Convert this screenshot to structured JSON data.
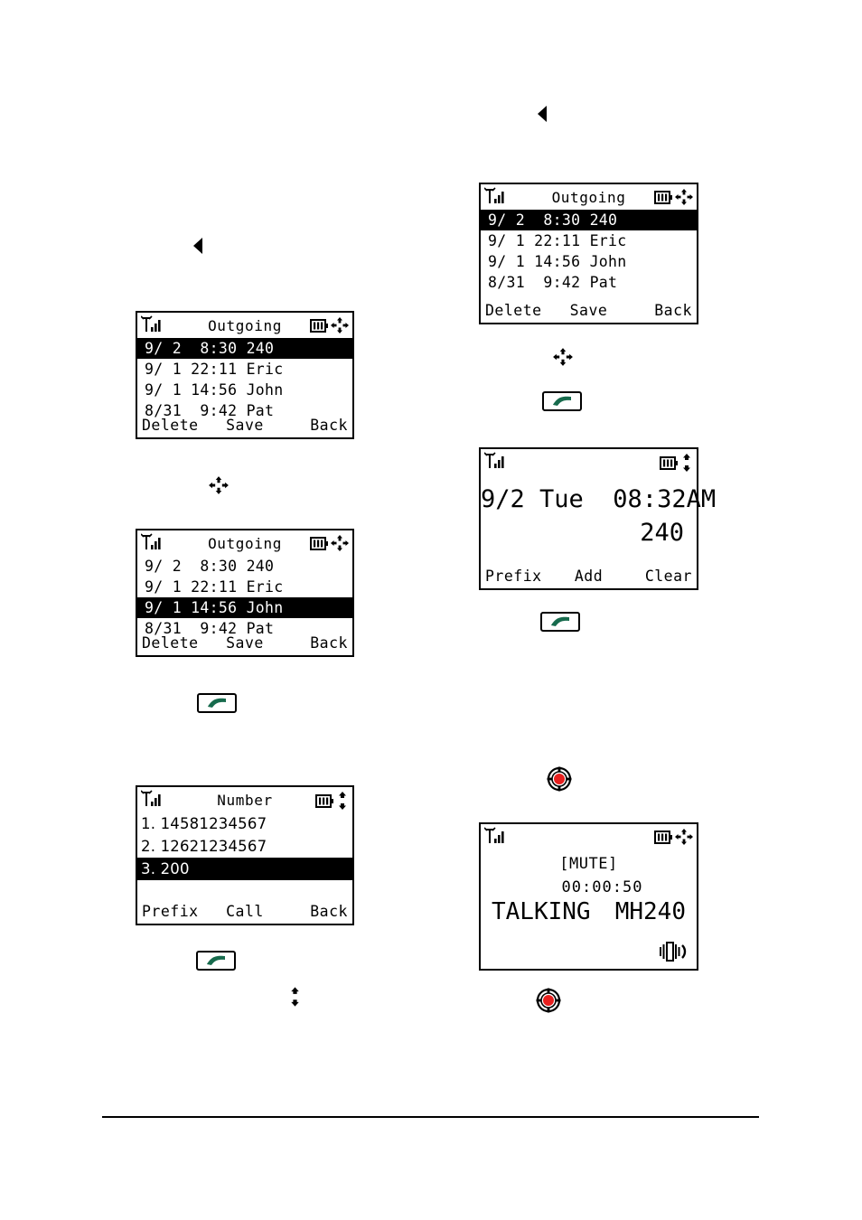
{
  "doc": {
    "type": "phone-manual-flow-diagram",
    "background": "#ffffff",
    "rule_color": "#000000"
  },
  "icons": {
    "signal": "signal-bars-icon",
    "battery": "battery-icon",
    "fourway": "four-way-navigation-icon",
    "updown": "up-down-navigation-icon",
    "triangle_left": "left-triangle-icon",
    "call_button": "green-call-button-icon",
    "mute_button": "red-mute-button-icon",
    "speaker": "speaker-vibrate-icon"
  },
  "screens": {
    "outgoing_left_1": {
      "title": "Outgoing",
      "rows": [
        {
          "text": "9/ 2  8:30 240",
          "selected": true
        },
        {
          "text": "9/ 1 22:11 Eric",
          "selected": false
        },
        {
          "text": "9/ 1 14:56 John",
          "selected": false
        },
        {
          "text": "8/31  9:42 Pat",
          "selected": false
        }
      ],
      "softkeys": {
        "left": "Delete",
        "center": "Save",
        "right": "Back"
      }
    },
    "outgoing_left_2": {
      "title": "Outgoing",
      "rows": [
        {
          "text": "9/ 2  8:30 240",
          "selected": false
        },
        {
          "text": "9/ 1 22:11 Eric",
          "selected": false
        },
        {
          "text": "9/ 1 14:56 John",
          "selected": true
        },
        {
          "text": "8/31  9:42 Pat",
          "selected": false
        }
      ],
      "softkeys": {
        "left": "Delete",
        "center": "Save",
        "right": "Back"
      }
    },
    "number_list": {
      "title": "Number",
      "rows": [
        {
          "text": "1. 14581234567",
          "selected": false
        },
        {
          "text": "2. 12621234567",
          "selected": false
        },
        {
          "text": "3. 200",
          "selected": true
        }
      ],
      "softkeys": {
        "left": "Prefix",
        "center": "Call",
        "right": "Back"
      }
    },
    "outgoing_right_1": {
      "title": "Outgoing",
      "rows": [
        {
          "text": "9/ 2  8:30 240",
          "selected": true
        },
        {
          "text": "9/ 1 22:11 Eric",
          "selected": false
        },
        {
          "text": "9/ 1 14:56 John",
          "selected": false
        },
        {
          "text": "8/31  9:42 Pat",
          "selected": false
        }
      ],
      "softkeys": {
        "left": "Delete",
        "center": "Save",
        "right": "Back"
      }
    },
    "dial": {
      "datetime": "9/2 Tue  08:32AM",
      "number": "240",
      "softkeys": {
        "left": "Prefix",
        "center": "Add",
        "right": "Clear"
      }
    },
    "talking": {
      "mute": "[MUTE]",
      "timer": "00:00:50",
      "state": "TALKING",
      "peer": "MH240"
    }
  }
}
